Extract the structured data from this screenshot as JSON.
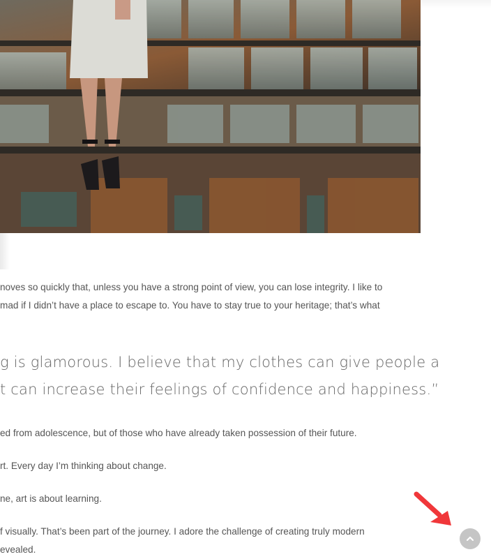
{
  "article": {
    "hero_image": {
      "description_icon": "fashion-photo-icon"
    },
    "paragraph_1": {
      "line_1": "noves so quickly that, unless you have a strong point of view, you can lose integrity. I like to",
      "line_2": "mad if I didn’t have a place to escape to. You have to stay true to your heritage; that’s what"
    },
    "blockquote": {
      "line_1": "g is glamorous. I believe that my clothes can give people a",
      "line_2": "t can increase their feelings of confidence and happiness.”"
    },
    "paragraph_2": "ed from adolescence, but of those who have already taken possession of their future.",
    "paragraph_3": "rt. Every day I’m thinking about change.",
    "paragraph_4": "ne, art is about learning.",
    "paragraph_5": {
      "line_1": "f visually. That’s been part of the journey. I adore the challenge of creating truly modern",
      "line_2": "evealed."
    }
  },
  "scroll_to_top": {
    "icon": "chevron-up-icon",
    "color": "#c5c5c5"
  },
  "annotation": {
    "icon": "red-arrow-icon",
    "color": "#f0373a"
  }
}
